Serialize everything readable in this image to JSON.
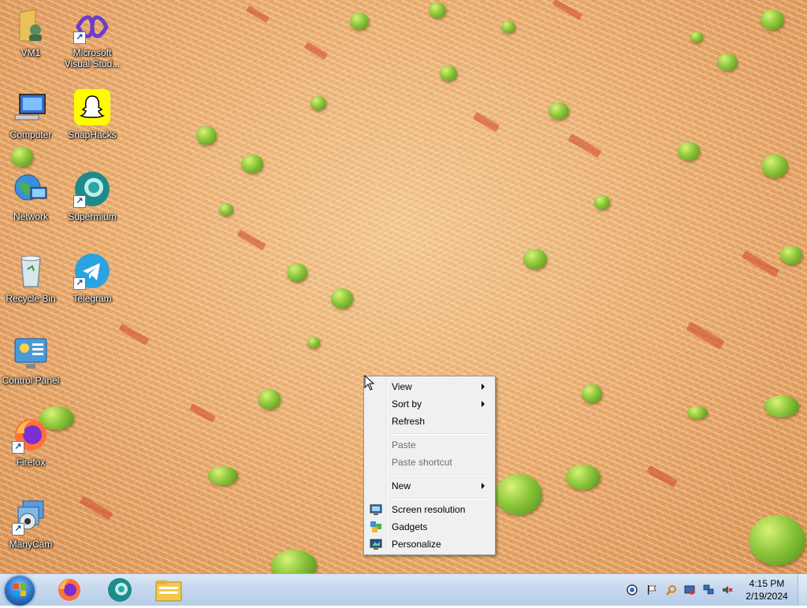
{
  "desktop": {
    "icons": [
      {
        "label": "VM1"
      },
      {
        "label": "Microsoft\nVisual Stud..."
      },
      {
        "label": "Computer"
      },
      {
        "label": "SnapHacks"
      },
      {
        "label": "Network"
      },
      {
        "label": "Supermium"
      },
      {
        "label": "Recycle Bin"
      },
      {
        "label": "Telegram"
      },
      {
        "label": "Control Panel"
      },
      {
        "label": "Firefox"
      },
      {
        "label": "ManyCam"
      }
    ]
  },
  "context_menu": {
    "view": "View",
    "sort_by": "Sort by",
    "refresh": "Refresh",
    "paste": "Paste",
    "paste_shortcut": "Paste shortcut",
    "new": "New",
    "screen_resolution": "Screen resolution",
    "gadgets": "Gadgets",
    "personalize": "Personalize"
  },
  "taskbar": {
    "pinned": [
      "firefox-icon",
      "supermium-icon",
      "file-explorer-icon"
    ],
    "tray_icons": [
      "network-status-icon",
      "action-center-flag-icon",
      "search-tray-icon",
      "display-tray-icon",
      "network-tray-icon",
      "volume-muted-icon"
    ],
    "time": "4:15 PM",
    "date": "2/19/2024"
  },
  "colors": {
    "taskbar": "#c6d8ee",
    "menu_bg": "#f0f0f0",
    "disabled_text": "#6d6d6d"
  }
}
